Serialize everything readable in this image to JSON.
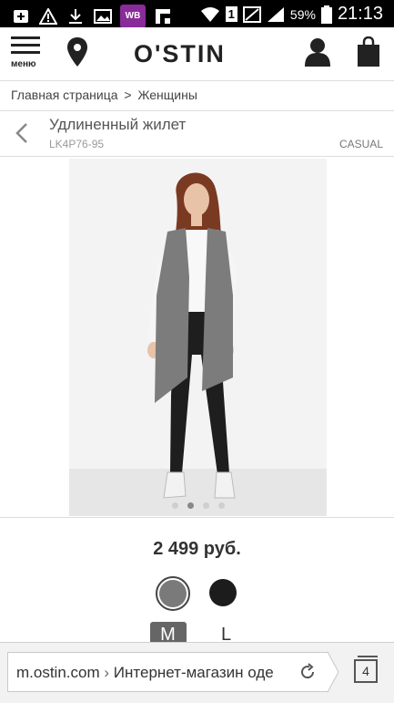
{
  "status_bar": {
    "notifications": [
      "usb-icon",
      "warning-icon",
      "download-icon",
      "image-icon",
      "wb-app-icon",
      "flipboard-icon"
    ],
    "wb_label": "WB",
    "sim_slot": "1",
    "battery_percent": "59%",
    "time": "21:13"
  },
  "header": {
    "menu_label": "меню",
    "logo": "O'STIN"
  },
  "breadcrumb": {
    "items": [
      "Главная страница",
      "Женщины"
    ],
    "separator": ">"
  },
  "product": {
    "title": "Удлиненный жилет",
    "sku": "LK4P76-95",
    "category": "CASUAL",
    "price": "2 499 руб.",
    "image_count": 4,
    "active_image_index": 1,
    "colors": [
      {
        "name": "grey",
        "hex": "#7a7a7a",
        "selected": true
      },
      {
        "name": "black",
        "hex": "#1c1c1c",
        "selected": false
      }
    ],
    "sizes": [
      {
        "label": "M",
        "selected": true
      },
      {
        "label": "L",
        "selected": false
      }
    ]
  },
  "browser": {
    "url_domain": "m.ostin.com",
    "url_separator": "›",
    "url_title": "Интернет-магазин оде",
    "tab_count": "4"
  }
}
